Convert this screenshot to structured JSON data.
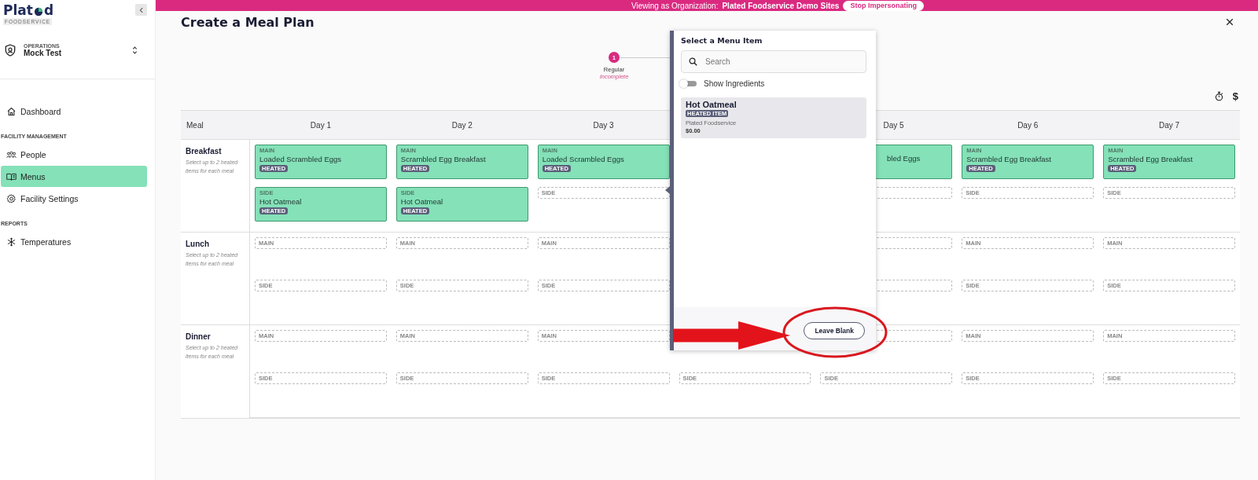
{
  "banner": {
    "prefix": "Viewing as Organization:",
    "organization": "Plated Foodservice Demo Sites",
    "action": "Stop Impersonating"
  },
  "sidebar": {
    "logo": {
      "before": "Plat",
      "after": "d",
      "tagline": "FOODSERVICE"
    },
    "org": {
      "role": "OPERATIONS",
      "name": "Mock Test"
    },
    "sections": [
      {
        "items": [
          {
            "label": "Dashboard",
            "selected": false
          }
        ]
      },
      {
        "heading": "FACILITY MANAGEMENT",
        "items": [
          {
            "label": "People",
            "selected": false
          },
          {
            "label": "Menus",
            "selected": true
          },
          {
            "label": "Facility Settings",
            "selected": false
          }
        ]
      },
      {
        "heading": "REPORTS",
        "items": [
          {
            "label": "Temperatures",
            "selected": false
          }
        ]
      }
    ]
  },
  "page": {
    "title": "Create a Meal Plan",
    "steps": [
      {
        "number": "1",
        "label": "Regular",
        "status": "Incomplete",
        "selected": true
      }
    ],
    "toolbar": {
      "currency": "$"
    }
  },
  "table": {
    "meal_heading": "Meal",
    "days": [
      {
        "kind": "plain",
        "label": "Day 1"
      },
      {
        "kind": "plain",
        "label": "Day 2"
      },
      {
        "kind": "plain",
        "label": "Day 3"
      },
      {
        "kind": "covered"
      },
      {
        "kind": "clipped",
        "label": "Day 5"
      },
      {
        "kind": "plain",
        "label": "Day 6"
      },
      {
        "kind": "plain",
        "label": "Day 7"
      }
    ],
    "meals": [
      {
        "name": "Breakfast",
        "hint": "Select up to 2 heated items for each meal",
        "cells": [
          {
            "main": {
              "kind": "filled",
              "label": "MAIN",
              "name": "Loaded Scrambled Eggs",
              "badge": "HEATED"
            },
            "side": {
              "kind": "filled",
              "label": "SIDE",
              "name": "Hot Oatmeal",
              "badge": "HEATED"
            }
          },
          {
            "main": {
              "kind": "filled",
              "label": "MAIN",
              "name": "Scrambled Egg Breakfast",
              "badge": "HEATED"
            },
            "side": {
              "kind": "filled",
              "label": "SIDE",
              "name": "Hot Oatmeal",
              "badge": "HEATED"
            }
          },
          {
            "main": {
              "kind": "filled",
              "label": "MAIN",
              "name": "Loaded Scrambled Eggs",
              "badge": "HEATED"
            },
            "side": {
              "kind": "empty",
              "label": "SIDE"
            }
          },
          {},
          {
            "main": {
              "kind": "filled",
              "name": "bled Eggs"
            },
            "side": {
              "kind": "empty"
            }
          },
          {
            "main": {
              "kind": "filled",
              "label": "MAIN",
              "name": "Scrambled Egg Breakfast",
              "badge": "HEATED"
            },
            "side": {
              "kind": "empty",
              "label": "SIDE"
            }
          },
          {
            "main": {
              "kind": "filled",
              "label": "MAIN",
              "name": "Scrambled Egg Breakfast",
              "badge": "HEATED"
            },
            "side": {
              "kind": "empty",
              "label": "SIDE"
            }
          }
        ]
      },
      {
        "name": "Lunch",
        "hint": "Select up to 2 heated items for each meal",
        "cells": [
          {
            "main": {
              "kind": "empty",
              "label": "MAIN"
            },
            "side": {
              "kind": "empty",
              "label": "SIDE"
            }
          },
          {
            "main": {
              "kind": "empty",
              "label": "MAIN"
            },
            "side": {
              "kind": "empty",
              "label": "SIDE"
            }
          },
          {
            "main": {
              "kind": "empty",
              "label": "MAIN"
            },
            "side": {
              "kind": "empty",
              "label": "SIDE"
            }
          },
          {},
          {
            "main": {
              "kind": "empty"
            },
            "side": {
              "kind": "empty"
            }
          },
          {
            "main": {
              "kind": "empty",
              "label": "MAIN"
            },
            "side": {
              "kind": "empty",
              "label": "SIDE"
            }
          },
          {
            "main": {
              "kind": "empty",
              "label": "MAIN"
            },
            "side": {
              "kind": "empty",
              "label": "SIDE"
            }
          }
        ]
      },
      {
        "name": "Dinner",
        "hint": "Select up to 2 heated items for each meal",
        "cells": [
          {
            "main": {
              "kind": "empty",
              "label": "MAIN"
            },
            "side": {
              "kind": "empty",
              "label": "SIDE"
            }
          },
          {
            "main": {
              "kind": "empty",
              "label": "MAIN"
            },
            "side": {
              "kind": "empty",
              "label": "SIDE"
            }
          },
          {
            "main": {
              "kind": "empty",
              "label": "MAIN"
            },
            "side": {
              "kind": "empty",
              "label": "SIDE"
            }
          },
          {
            "side": {
              "kind": "empty",
              "label": "SIDE"
            }
          },
          {
            "main": {
              "kind": "empty"
            },
            "side": {
              "kind": "empty",
              "label": "SIDE"
            }
          },
          {
            "main": {
              "kind": "empty",
              "label": "MAIN"
            },
            "side": {
              "kind": "empty",
              "label": "SIDE"
            }
          },
          {
            "main": {
              "kind": "empty",
              "label": "MAIN"
            },
            "side": {
              "kind": "empty",
              "label": "SIDE"
            }
          }
        ]
      }
    ]
  },
  "popup": {
    "title": "Select a Menu Item",
    "search": {
      "placeholder": "Search"
    },
    "toggle": {
      "label": "Show Ingredients",
      "on": false
    },
    "items": [
      {
        "name": "Hot Oatmeal",
        "badge": "HEATED ITEM",
        "vendor": "Plated Foodservice",
        "price": "$0.00",
        "selected": true
      }
    ],
    "footer_button": "Leave Blank"
  }
}
